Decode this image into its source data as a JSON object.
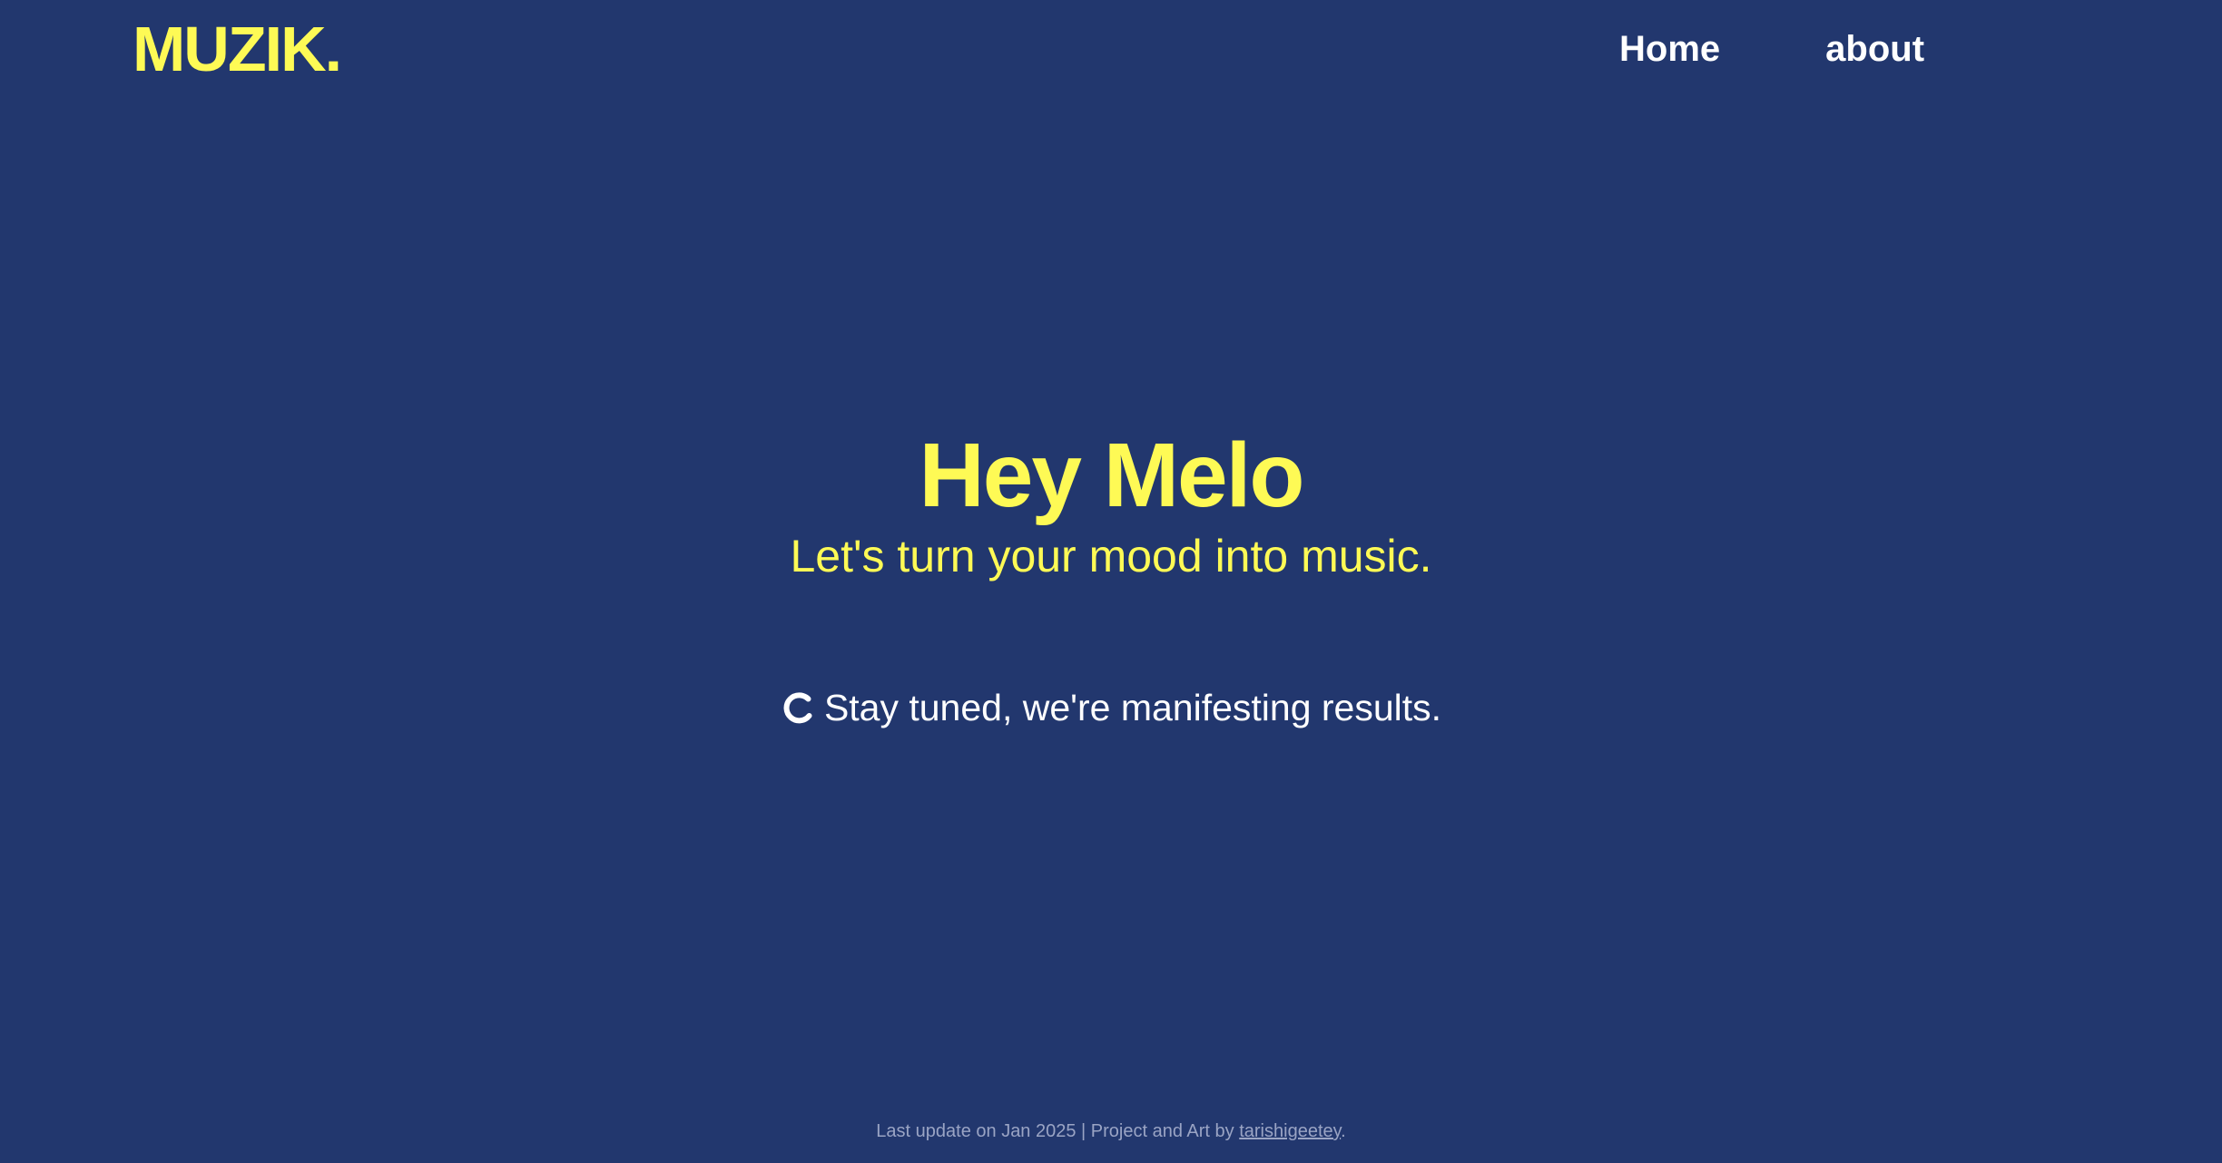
{
  "header": {
    "brand": "MUZIK.",
    "nav": {
      "home": "Home",
      "about": "about"
    }
  },
  "hero": {
    "title": "Hey Melo",
    "subtitle": "Let's turn your mood into music."
  },
  "status": {
    "icon": "loading-spinner-icon",
    "text": "Stay tuned, we're manifesting results."
  },
  "footer": {
    "prefix": "Last update on Jan 2025 | Project and Art by ",
    "author": "tarishigeetey",
    "suffix": "."
  },
  "colors": {
    "background": "#22376e",
    "accent": "#fefa55",
    "text": "#ffffff",
    "muted": "#9aa4c4"
  }
}
